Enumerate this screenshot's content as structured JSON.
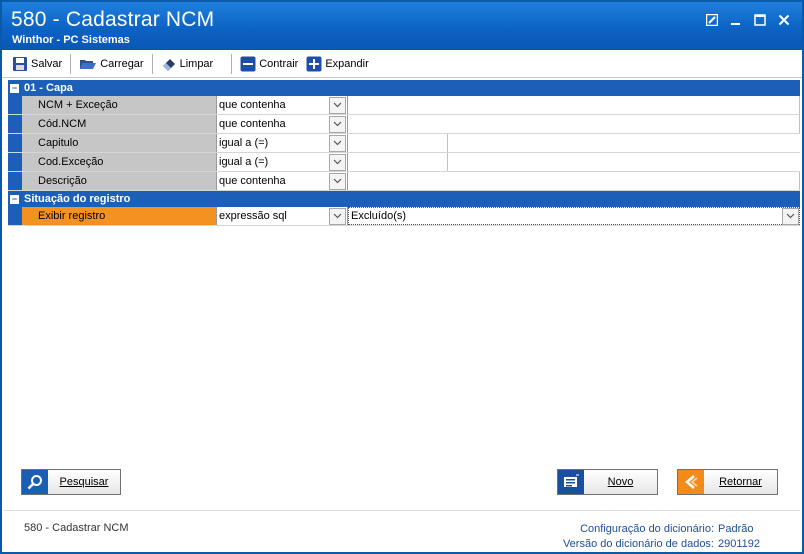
{
  "window": {
    "title": "580 - Cadastrar  NCM",
    "subtitle": "Winthor - PC Sistemas"
  },
  "toolbar": {
    "save_label": "Salvar",
    "load_label": "Carregar",
    "clear_label": "Limpar",
    "collapse_label": "Contrair",
    "expand_label": "Expandir"
  },
  "sections": {
    "capa": {
      "title": "01 - Capa",
      "rows": [
        {
          "label": "NCM + Exceção",
          "operator": "que contenha"
        },
        {
          "label": "Cód.NCM",
          "operator": "que contenha"
        },
        {
          "label": "Capitulo",
          "operator": "igual a (=)"
        },
        {
          "label": "Cod.Exceção",
          "operator": "igual a (=)"
        },
        {
          "label": "Descrição",
          "operator": "que contenha"
        }
      ]
    },
    "situacao": {
      "title": "Situação do registro",
      "rows": [
        {
          "label": "Exibir registro",
          "operator": "expressão sql",
          "value": "Excluído(s)"
        }
      ]
    }
  },
  "buttons": {
    "search_label": "Pesquisar",
    "new_label": "Novo",
    "back_label": "Retornar"
  },
  "footer": {
    "left": "580 - Cadastrar  NCM",
    "config_label": "Configuração do dicionário:",
    "config_value": "Padrão",
    "version_label": "Versão do dicionário de dados:",
    "version_value": "2901192"
  },
  "colors": {
    "title_bar": "#0c63c4",
    "section_header": "#1c5fb8",
    "selected_row": "#f39121"
  }
}
